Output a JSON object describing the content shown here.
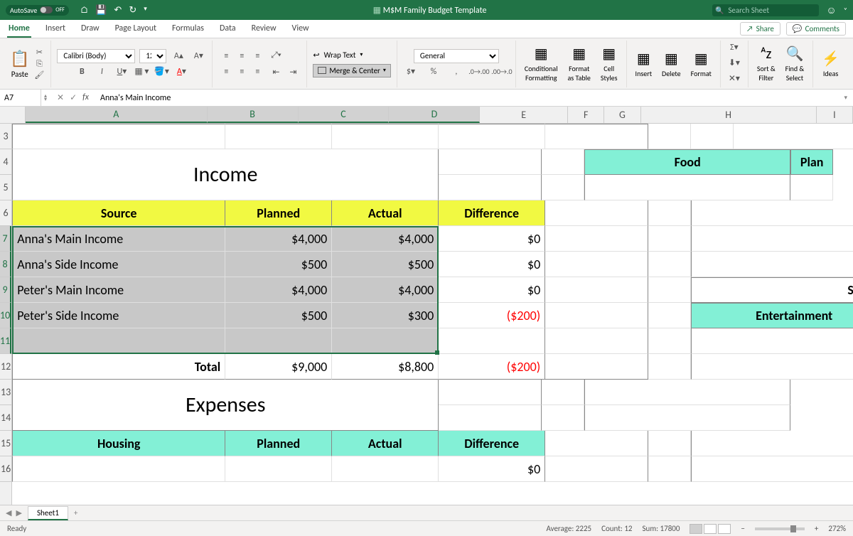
{
  "titlebar": {
    "autosave": "AutoSave",
    "autosave_state": "OFF",
    "title": "M$M Family Budget Template",
    "search_placeholder": "Search Sheet"
  },
  "tabs": {
    "items": [
      "Home",
      "Insert",
      "Draw",
      "Page Layout",
      "Formulas",
      "Data",
      "Review",
      "View"
    ],
    "active": "Home",
    "share": "Share",
    "comments": "Comments"
  },
  "ribbon": {
    "paste": "Paste",
    "font_name": "Calibri (Body)",
    "font_size": "12",
    "wrap_text": "Wrap Text",
    "merge_center": "Merge & Center",
    "number_format": "General",
    "conditional_formatting": "Conditional\nFormatting",
    "format_as_table": "Format\nas Table",
    "cell_styles": "Cell\nStyles",
    "insert": "Insert",
    "delete": "Delete",
    "format": "Format",
    "sort_filter": "Sort &\nFilter",
    "find_select": "Find &\nSelect",
    "ideas": "Ideas"
  },
  "formula_bar": {
    "cell_ref": "A7",
    "formula": "Anna's Main Income"
  },
  "columns": [
    "A",
    "B",
    "C",
    "D",
    "E",
    "F",
    "G",
    "H",
    "I"
  ],
  "rows": [
    "3",
    "4",
    "5",
    "6",
    "7",
    "8",
    "9",
    "10",
    "11",
    "12",
    "13",
    "14",
    "15",
    "16"
  ],
  "sheet": {
    "income_title": "Income",
    "expenses_title": "Expenses",
    "headers": {
      "source": "Source",
      "planned": "Planned",
      "actual": "Actual",
      "difference": "Difference"
    },
    "income_rows": [
      {
        "source": "Anna's Main Income",
        "planned": "$4,000",
        "actual": "$4,000",
        "diff": "$0"
      },
      {
        "source": "Anna's Side Income",
        "planned": "$500",
        "actual": "$500",
        "diff": "$0"
      },
      {
        "source": "Peter's Main Income",
        "planned": "$4,000",
        "actual": "$4,000",
        "diff": "$0"
      },
      {
        "source": "Peter's Side Income",
        "planned": "$500",
        "actual": "$300",
        "diff": "($200)"
      }
    ],
    "total_label": "Total",
    "total_planned": "$9,000",
    "total_actual": "$8,800",
    "total_diff": "($200)",
    "housing": "Housing",
    "row16_diff": "$0",
    "food": "Food",
    "plan": "Plan",
    "subtotal": "Subtotal",
    "entertainment": "Entertainment"
  },
  "sheet_tab": "Sheet1",
  "statusbar": {
    "ready": "Ready",
    "average": "Average: 2225",
    "count": "Count: 12",
    "sum": "Sum: 17800",
    "zoom": "272%"
  }
}
